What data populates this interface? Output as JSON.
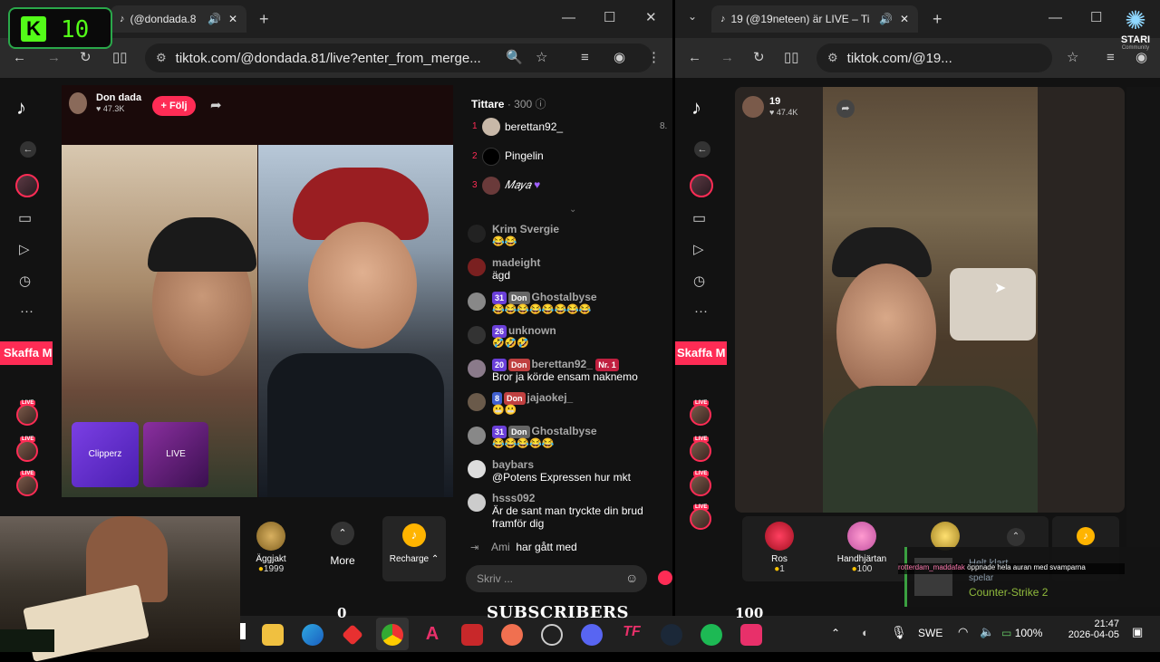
{
  "overlay": {
    "k_letter": "K",
    "k_number": "10",
    "star_brand": "STARI",
    "star_sub": "Community"
  },
  "left_window": {
    "tab_title": "(@dondada.8",
    "url": "tiktok.com/@dondada.81/live?enter_from_merge...",
    "host": {
      "name": "Don dada",
      "likes": "47.3K",
      "follow": "+ Följ"
    },
    "promo": "Skaffa M",
    "cards": [
      "Clipperz",
      "LIVE"
    ],
    "viewers": {
      "title": "Tittare",
      "count": "300",
      "list": [
        {
          "rank": "1",
          "name": "berettan92_",
          "score": "8."
        },
        {
          "rank": "2",
          "name": "Pingelin"
        },
        {
          "rank": "3",
          "name": "𝑀𝑎𝑦𝑎"
        }
      ]
    },
    "chat": [
      {
        "name": "Krim Svergie",
        "text": "😂😂"
      },
      {
        "name": "madeight",
        "text": "ägd"
      },
      {
        "level": "31",
        "team": "Don",
        "name": "Ghostalbyse",
        "text": "😂😂😂😂😂😂😂😂"
      },
      {
        "level": "26",
        "name": "unknown",
        "text": "🤣🤣🤣"
      },
      {
        "level": "20",
        "team": "Don",
        "name": "berettan92_",
        "rankbadge": "Nr. 1",
        "text": "Bror ja körde ensam naknemo"
      },
      {
        "level": "8",
        "team": "Don",
        "name": "jajaokej_",
        "text": "😬😬"
      },
      {
        "level": "31",
        "team": "Don",
        "name": "Ghostalbyse",
        "text": "😂😂😂😂😂"
      },
      {
        "name": "baybars",
        "text": "@Potens Expressen hur mkt"
      },
      {
        "name": "hsss092",
        "text": "Är de sant man tryckte din brud framför dig"
      }
    ],
    "joined": {
      "name": "Ami",
      "text": "har gått med"
    },
    "input_placeholder": "Skriv ...",
    "gifts": [
      {
        "name": "Äggjakt",
        "price": "1999"
      }
    ],
    "more": "More",
    "recharge": "Recharge"
  },
  "right_window": {
    "tab_title": "19 (@19neteen) är LIVE – Ti",
    "url": "tiktok.com/@19...",
    "host": {
      "name": "19",
      "likes": "47.4K"
    },
    "promo": "Skaffa M",
    "gifts": [
      {
        "name": "Ros",
        "price": "1"
      },
      {
        "name": "Handhjärtan",
        "price": "100"
      }
    ]
  },
  "notification": {
    "title": "Helt klart",
    "user": "rotterdam_maddafak",
    "event": "öppnade hela auran med svamparna",
    "status": "spelar",
    "game": "Counter-Strike 2"
  },
  "ticker": {
    "left": "0",
    "center": "SUBSCRIBERS",
    "right": "100"
  },
  "taskbar": {
    "lang": "SWE",
    "battery": "100%",
    "time": "21:47",
    "date": "2026-04-05"
  }
}
